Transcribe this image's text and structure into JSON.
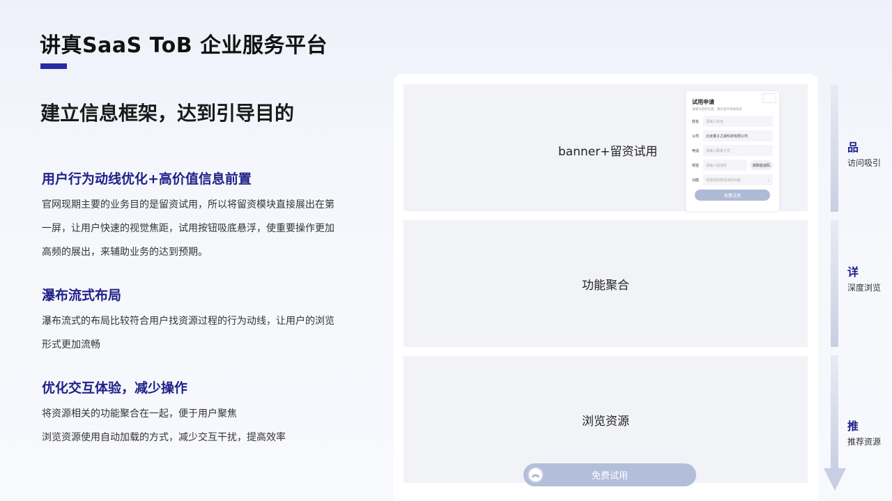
{
  "header": {
    "title": "讲真SaaS ToB  企业服务平台",
    "subtitle": "建立信息框架，达到引导目的"
  },
  "sections": [
    {
      "heading": "用户行为动线优化+高价值信息前置",
      "lines": [
        "官网现期主要的业务目的是留资试用，所以将留资模块直接展出在第",
        "一屏，让用户快速的视觉焦距，试用按钮吸底悬浮，使重要操作更加",
        "高频的展出，来辅助业务的达到预期。"
      ]
    },
    {
      "heading": "瀑布流式布局",
      "lines": [
        "瀑布流式的布局比较符合用户找资源过程的行为动线，让用户的浏览",
        "形式更加流畅"
      ]
    },
    {
      "heading": "优化交互体验，减少操作",
      "lines": [
        "将资源相关的功能聚合在一起，便于用户聚焦",
        "浏览资源使用自动加载的方式，减少交互干扰，提高效率"
      ]
    }
  ],
  "wireframe": {
    "block1_label": "banner+留资试用",
    "block2_label": "功能聚合",
    "block3_label": "浏览资源",
    "trial_button": "免费试用",
    "form": {
      "title": "试用申请",
      "subtitle": "请填写您的信息，我们会尽快联系您",
      "fields": [
        {
          "label": "姓名",
          "placeholder": "请输入姓名"
        },
        {
          "label": "公司",
          "value": "北京量子之歌科技有限公司"
        },
        {
          "label": "电话",
          "placeholder": "请输入联系方式"
        },
        {
          "label": "校验",
          "placeholder": "请输入验证码",
          "action": "获取验证码"
        },
        {
          "label": "功能",
          "placeholder": "请选择您想试用的功能"
        }
      ],
      "submit": "免费试用"
    }
  },
  "stages": [
    {
      "key": "品",
      "desc": "访问吸引"
    },
    {
      "key": "详",
      "desc": "深度浏览"
    },
    {
      "key": "推",
      "desc": "推荐资源"
    }
  ],
  "colors": {
    "accent": "#20208a",
    "bar": "#2a2aa6",
    "button": "#b3bedb"
  }
}
